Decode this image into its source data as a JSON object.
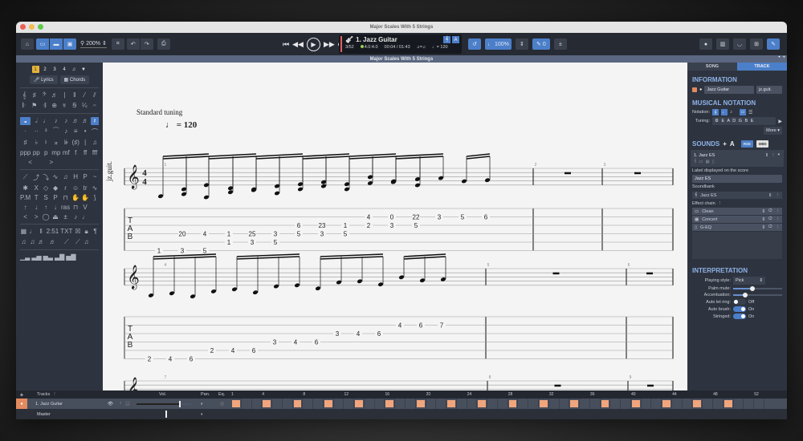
{
  "window": {
    "title": "Major Scales With 5 Strings",
    "subtitle": "Major Scales With 5 Strings"
  },
  "toolbar": {
    "home_icon": "home-icon",
    "zoom_value": "200%",
    "undo_icon": "undo-icon",
    "redo_icon": "redo-icon",
    "print_icon": "print-icon",
    "transport": {
      "first": "⏮",
      "rewind": "◀◀",
      "play": "▶",
      "forward": "▶▶",
      "last": "⏭"
    },
    "lcd": {
      "track_name": "1. Jazz Guitar",
      "bar_position": "3/52",
      "time_signature": "4.0:4.0",
      "time": "00:04 / 01:43",
      "rhythm": "♫=♫",
      "tempo": "♩= 120"
    },
    "loop_label": "↺",
    "speed_value": "100%",
    "pitch_value": "0"
  },
  "palette": {
    "voices": [
      "1",
      "2",
      "3",
      "4"
    ],
    "active_voice": "1",
    "lyrics_label": "Lyrics",
    "chords_label": "Chords",
    "row_text": [
      "2:51",
      "TXT"
    ]
  },
  "score": {
    "tuning_label": "Standard tuning",
    "tempo_label": "= 120",
    "track_label": "jz.guit.",
    "time_sig_top": "4",
    "time_sig_bottom": "4",
    "tab_letters": [
      "T",
      "A",
      "B"
    ],
    "systems": [
      {
        "bars": [
          "1",
          "2",
          "3"
        ],
        "tab_numbers": [
          {
            "t": "1",
            "s": 6
          },
          {
            "t": "20",
            "s": 4
          },
          {
            "t": "3",
            "s": 6
          },
          {
            "t": "4",
            "s": 4
          },
          {
            "t": "5",
            "s": 6
          },
          {
            "t": "1",
            "s": 4
          },
          {
            "t": "1",
            "s": 5
          },
          {
            "t": "25",
            "s": 4
          },
          {
            "t": "3",
            "s": 5
          },
          {
            "t": "3",
            "s": 4
          },
          {
            "t": "5",
            "s": 5
          },
          {
            "t": "6",
            "s": 3
          },
          {
            "t": "5",
            "s": 4
          },
          {
            "t": "23",
            "s": 3
          },
          {
            "t": "3",
            "s": 4
          },
          {
            "t": "1",
            "s": 3
          },
          {
            "t": "5",
            "s": 4
          },
          {
            "t": "4",
            "s": 2
          },
          {
            "t": "2",
            "s": 3
          },
          {
            "t": "0",
            "s": 2
          },
          {
            "t": "3",
            "s": 3
          },
          {
            "t": "22",
            "s": 2
          },
          {
            "t": "5",
            "s": 3
          },
          {
            "t": "3",
            "s": 2
          },
          {
            "t": "5",
            "s": 2
          },
          {
            "t": "6",
            "s": 2
          }
        ]
      },
      {
        "bars": [
          "4",
          "5",
          "6"
        ],
        "tab_numbers": [
          {
            "t": "2",
            "s": 6
          },
          {
            "t": "4",
            "s": 6
          },
          {
            "t": "6",
            "s": 6
          },
          {
            "t": "2",
            "s": 5
          },
          {
            "t": "4",
            "s": 5
          },
          {
            "t": "6",
            "s": 5
          },
          {
            "t": "3",
            "s": 4
          },
          {
            "t": "4",
            "s": 4
          },
          {
            "t": "6",
            "s": 4
          },
          {
            "t": "3",
            "s": 3
          },
          {
            "t": "4",
            "s": 3
          },
          {
            "t": "6",
            "s": 3
          },
          {
            "t": "4",
            "s": 2
          },
          {
            "t": "6",
            "s": 2
          },
          {
            "t": "7",
            "s": 2
          }
        ]
      },
      {
        "bars": [
          "7",
          "8",
          "9"
        ]
      }
    ]
  },
  "panel": {
    "tabs": [
      "SONG",
      "TRACK"
    ],
    "active_tab": "TRACK",
    "information": {
      "title": "INFORMATION",
      "track_name": "Jazz Guitar",
      "short_name": "jz.guit.",
      "color": "#e38a5e"
    },
    "notation": {
      "title": "MUSICAL NOTATION",
      "notation_label": "Notation:",
      "tuning_label": "Tuning:",
      "tuning_value": "E A D G B E",
      "more_label": "More ▾"
    },
    "sounds": {
      "title": "SOUNDS",
      "rse_label": "RSE",
      "midi_label": "MIDI",
      "sound_name": "1. Jazz ES",
      "label_caption": "Label displayed on the score",
      "label_value": "Jazz ES",
      "soundbank_caption": "Soundbank",
      "soundbank_value": "Jazz ES",
      "effect_chain_caption": "Effect chain",
      "effects": [
        "Clean",
        "Concert",
        "G-EQ"
      ]
    },
    "interpretation": {
      "title": "INTERPRETATION",
      "playing_style_label": "Playing style:",
      "playing_style_value": "Pick",
      "palm_mute_label": "Palm mute:",
      "palm_mute_value": 0.4,
      "accentuation_label": "Accentuation:",
      "accentuation_value": 0.25,
      "auto_let_ring_label": "Auto let ring:",
      "auto_let_ring_value": "Off",
      "auto_brush_label": "Auto brush:",
      "auto_brush_value": "On",
      "stringed_label": "Stringed:",
      "stringed_value": "On"
    }
  },
  "tracks": {
    "header_label": "Tracks",
    "vol_label": "Vol.",
    "pan_label": "Pan.",
    "eq_label": "Eq.",
    "bar_numbers": [
      "1",
      "4",
      "8",
      "12",
      "16",
      "20",
      "24",
      "28",
      "32",
      "36",
      "40",
      "44",
      "48",
      "52"
    ],
    "rows": [
      {
        "name": "1. Jazz Guitar",
        "volume": 0.8
      },
      {
        "name": "Master",
        "volume": 0.8
      }
    ],
    "filled_bars": [
      1,
      4,
      7,
      10,
      13,
      16,
      19,
      22,
      25,
      28,
      31,
      34,
      37,
      40,
      43,
      46,
      49
    ],
    "total_bars": 52,
    "accent_color": "#f0a57c"
  }
}
